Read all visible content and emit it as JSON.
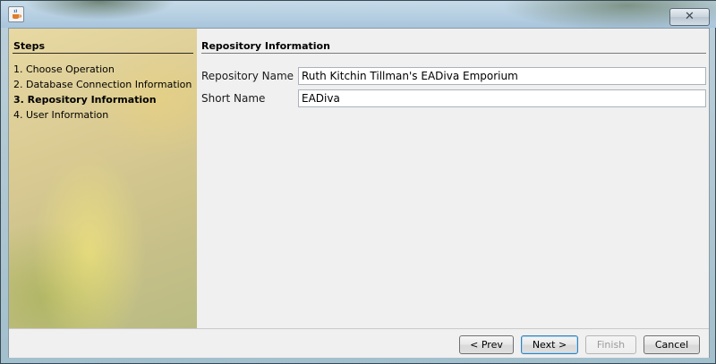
{
  "window": {
    "icon": "java-cup-icon",
    "close_label": "✕"
  },
  "steps": {
    "title": "Steps",
    "items": [
      {
        "label": "1. Choose Operation",
        "current": false
      },
      {
        "label": "2. Database Connection Information",
        "current": false
      },
      {
        "label": "3. Repository Information",
        "current": true
      },
      {
        "label": "4. User Information",
        "current": false
      }
    ]
  },
  "content": {
    "title": "Repository Information",
    "repository_name_label": "Repository Name",
    "repository_name_value": "Ruth Kitchin Tillman's EADiva Emporium",
    "short_name_label": "Short Name",
    "short_name_value": "EADiva"
  },
  "buttons": {
    "prev": "< Prev",
    "next": "Next >",
    "finish": "Finish",
    "cancel": "Cancel"
  }
}
